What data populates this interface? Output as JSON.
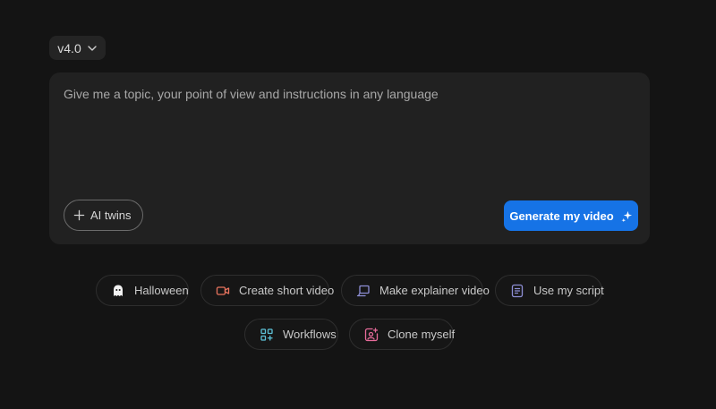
{
  "version_select": {
    "label": "v4.0",
    "chevron_icon": "chevron-down-icon"
  },
  "composer": {
    "placeholder": "Give me a topic, your point of view and instructions in any language",
    "value": ""
  },
  "ai_twins_button": {
    "label": "AI twins",
    "icon": "plus-icon"
  },
  "generate_button": {
    "label": "Generate my video",
    "icon": "sparkle-icon",
    "color": "#1673e6"
  },
  "suggestions": [
    {
      "label": "Halloween",
      "icon": "ghost-icon"
    },
    {
      "label": "Create short video",
      "icon": "video-camera-icon",
      "color": "#e8735e"
    },
    {
      "label": "Make explainer video",
      "icon": "presentation-icon",
      "color": "#8e8fd6"
    },
    {
      "label": "Use my script",
      "icon": "document-icon",
      "color": "#8e8fd6"
    },
    {
      "label": "Workflows",
      "icon": "workflow-grid-icon",
      "color": "#5ec3d9"
    },
    {
      "label": "Clone myself",
      "icon": "person-sparkle-icon",
      "color": "#e66b9a"
    }
  ]
}
